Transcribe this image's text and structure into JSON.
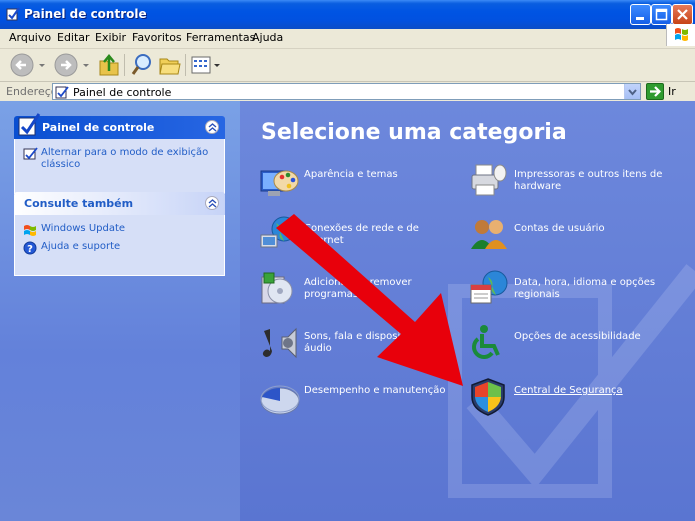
{
  "window": {
    "title": "Painel de controle"
  },
  "menu": {
    "items": [
      "Arquivo",
      "Editar",
      "Exibir",
      "Favoritos",
      "Ferramentas",
      "Ajuda"
    ]
  },
  "toolbar": {
    "icons": [
      "back-icon",
      "forward-icon",
      "up-folder-icon",
      "search-icon",
      "folders-icon",
      "views-icon"
    ]
  },
  "address": {
    "label": "Endereço",
    "value": "Painel de controle",
    "go_label": "Ir"
  },
  "sidebar": {
    "panel_title": "Painel de controle",
    "switch_link": "Alternar para o modo de exibição clássico",
    "see_also_title": "Consulte também",
    "see_also_links": [
      "Windows Update",
      "Ajuda e suporte"
    ]
  },
  "main": {
    "heading": "Selecione uma categoria",
    "categories": [
      {
        "label": "Aparência e temas",
        "icon": "appearance-icon"
      },
      {
        "label": "Impressoras e outros itens de hardware",
        "icon": "printer-icon"
      },
      {
        "label": "Conexões de rede e de Internet",
        "icon": "network-icon"
      },
      {
        "label": "Contas de usuário",
        "icon": "users-icon"
      },
      {
        "label": "Adicionar ou remover programas",
        "icon": "add-remove-icon"
      },
      {
        "label": "Data, hora, idioma e opções regionais",
        "icon": "date-time-icon"
      },
      {
        "label": "Sons, fala e dispositivos de áudio",
        "icon": "sounds-icon"
      },
      {
        "label": "Opções de acessibilidade",
        "icon": "accessibility-icon"
      },
      {
        "label": "Desempenho e manutenção",
        "icon": "performance-icon"
      },
      {
        "label": "Central de Segurança",
        "icon": "security-shield-icon"
      }
    ]
  },
  "annotation": {
    "color": "#e8000b"
  }
}
